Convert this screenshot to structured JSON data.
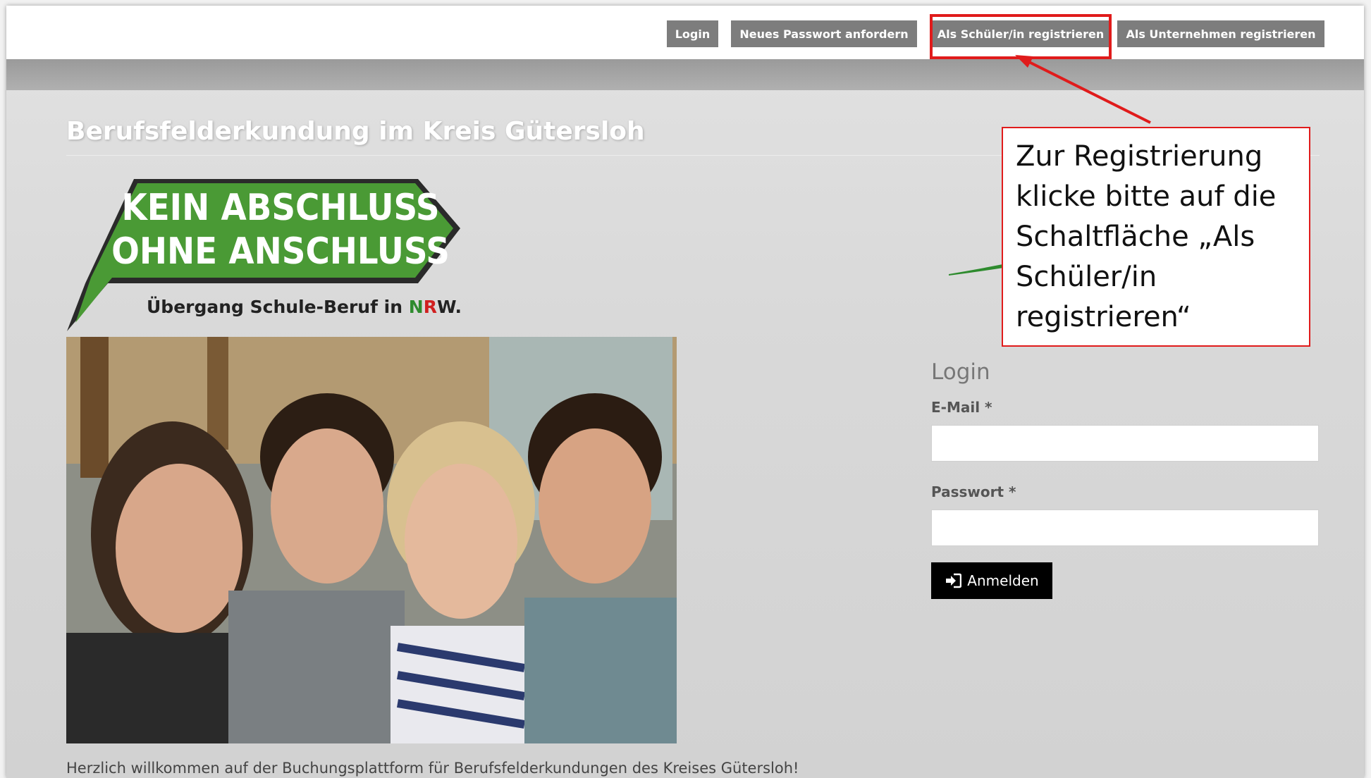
{
  "topnav": {
    "login": "Login",
    "reset_password": "Neues Passwort anfordern",
    "register_student": "Als Schüler/in registrieren",
    "register_company": "Als Unternehmen registrieren"
  },
  "page": {
    "title": "Berufsfelderkundung im Kreis Gütersloh",
    "welcome": "Herzlich willkommen auf der Buchungsplattform für Berufsfelderkundungen des Kreises Gütersloh!"
  },
  "logo": {
    "line1": "KEIN ABSCHLUSS",
    "line2": "OHNE ANSCHLUSS",
    "tagline_prefix": "Übergang Schule-Beruf in ",
    "tagline_n": "N",
    "tagline_r": "R",
    "tagline_w": "W."
  },
  "login": {
    "heading": "Login",
    "email_label": "E-Mail *",
    "email_value": "",
    "password_label": "Passwort *",
    "password_value": "",
    "submit_label": "Anmelden",
    "submit_icon": "sign-in-icon"
  },
  "callout": {
    "text_line1": "Zur Registrierung",
    "text_line2": "klicke bitte auf die",
    "text_line3": "Schaltfläche „Als",
    "text_line4": "Schüler/in",
    "text_line5": "registrieren“"
  },
  "colors": {
    "nav_button": "#7d7d7d",
    "highlight_red": "#e01b1b",
    "logo_green": "#3d8b2f",
    "submit_bg": "#000000"
  }
}
